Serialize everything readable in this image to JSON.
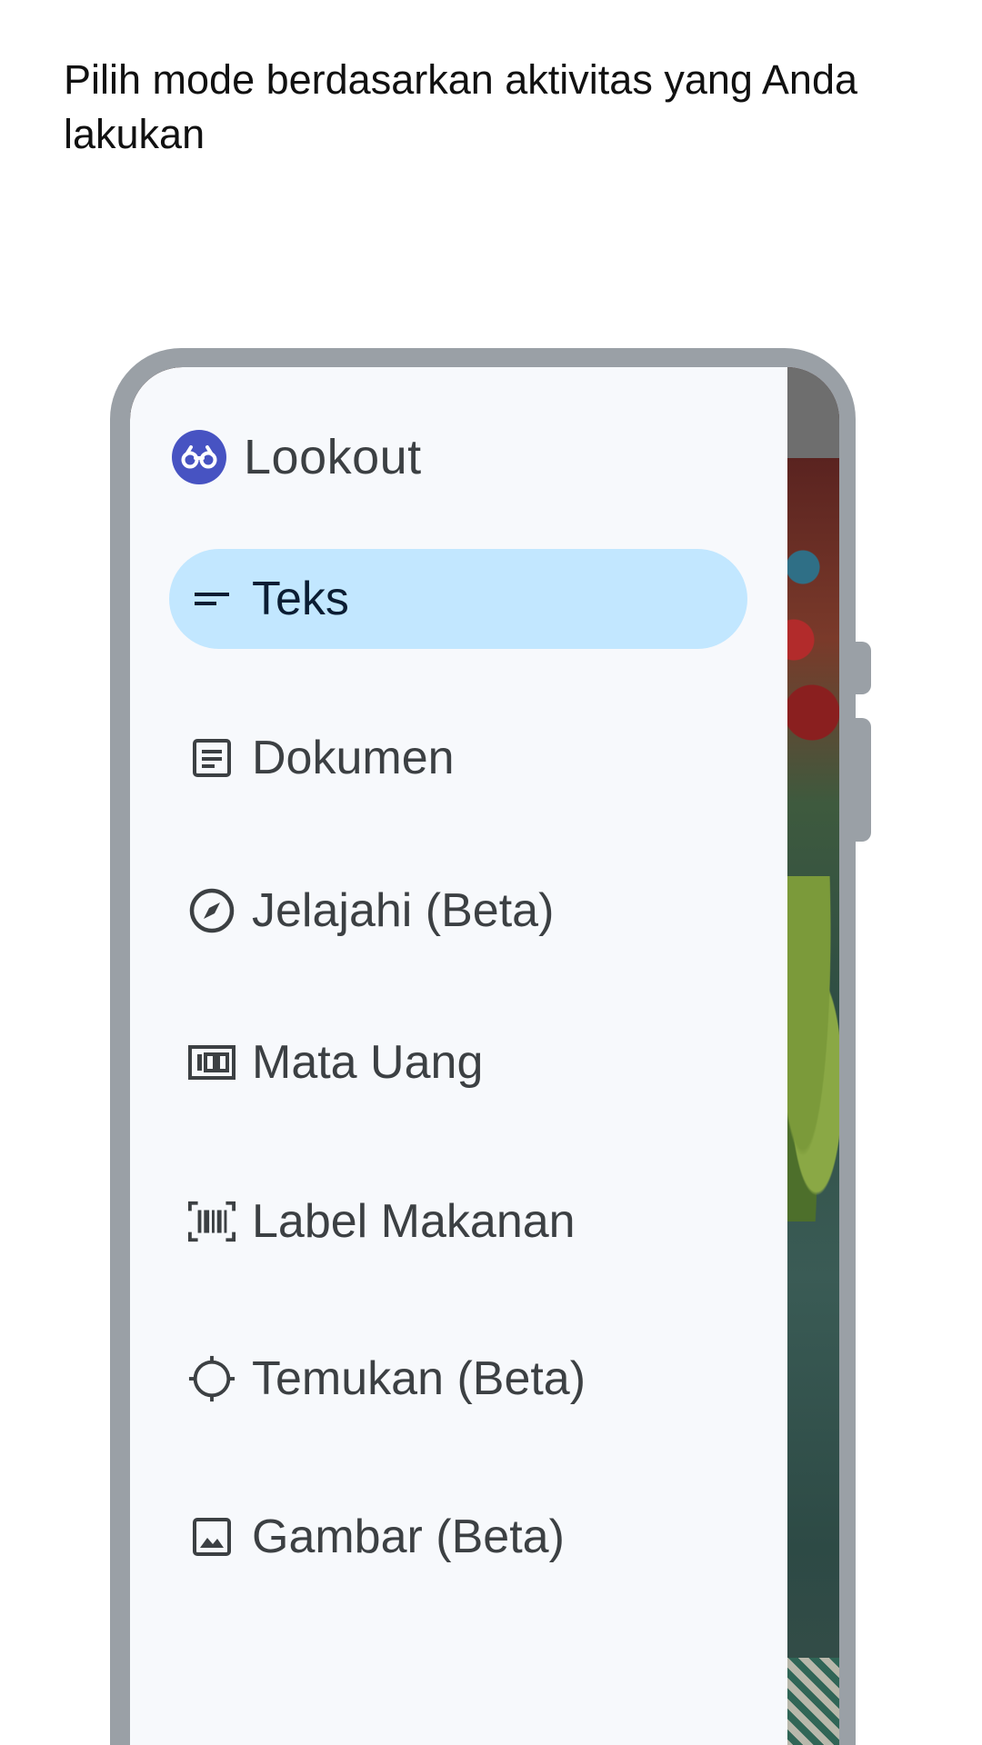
{
  "headline": "Pilih mode berdasarkan aktivitas yang Anda lakukan",
  "app": {
    "name": "Lookout",
    "logo_icon": "binoculars-icon",
    "logo_color": "#4753c2"
  },
  "menu": {
    "selected": "Teks",
    "items": [
      {
        "label": "Teks",
        "icon": "short-text-icon",
        "active": true
      },
      {
        "label": "Dokumen",
        "icon": "document-icon",
        "active": false
      },
      {
        "label": "Jelajahi (Beta)",
        "icon": "compass-icon",
        "active": false
      },
      {
        "label": "Mata Uang",
        "icon": "currency-icon",
        "active": false
      },
      {
        "label": "Label Makanan",
        "icon": "barcode-icon",
        "active": false
      },
      {
        "label": "Temukan (Beta)",
        "icon": "crosshair-icon",
        "active": false
      },
      {
        "label": "Gambar (Beta)",
        "icon": "image-icon",
        "active": false
      }
    ]
  },
  "colors": {
    "active_background": "#c2e7ff",
    "drawer_background": "#f7f9fc",
    "phone_frame": "#9aa0a6",
    "text": "#3c4043"
  }
}
